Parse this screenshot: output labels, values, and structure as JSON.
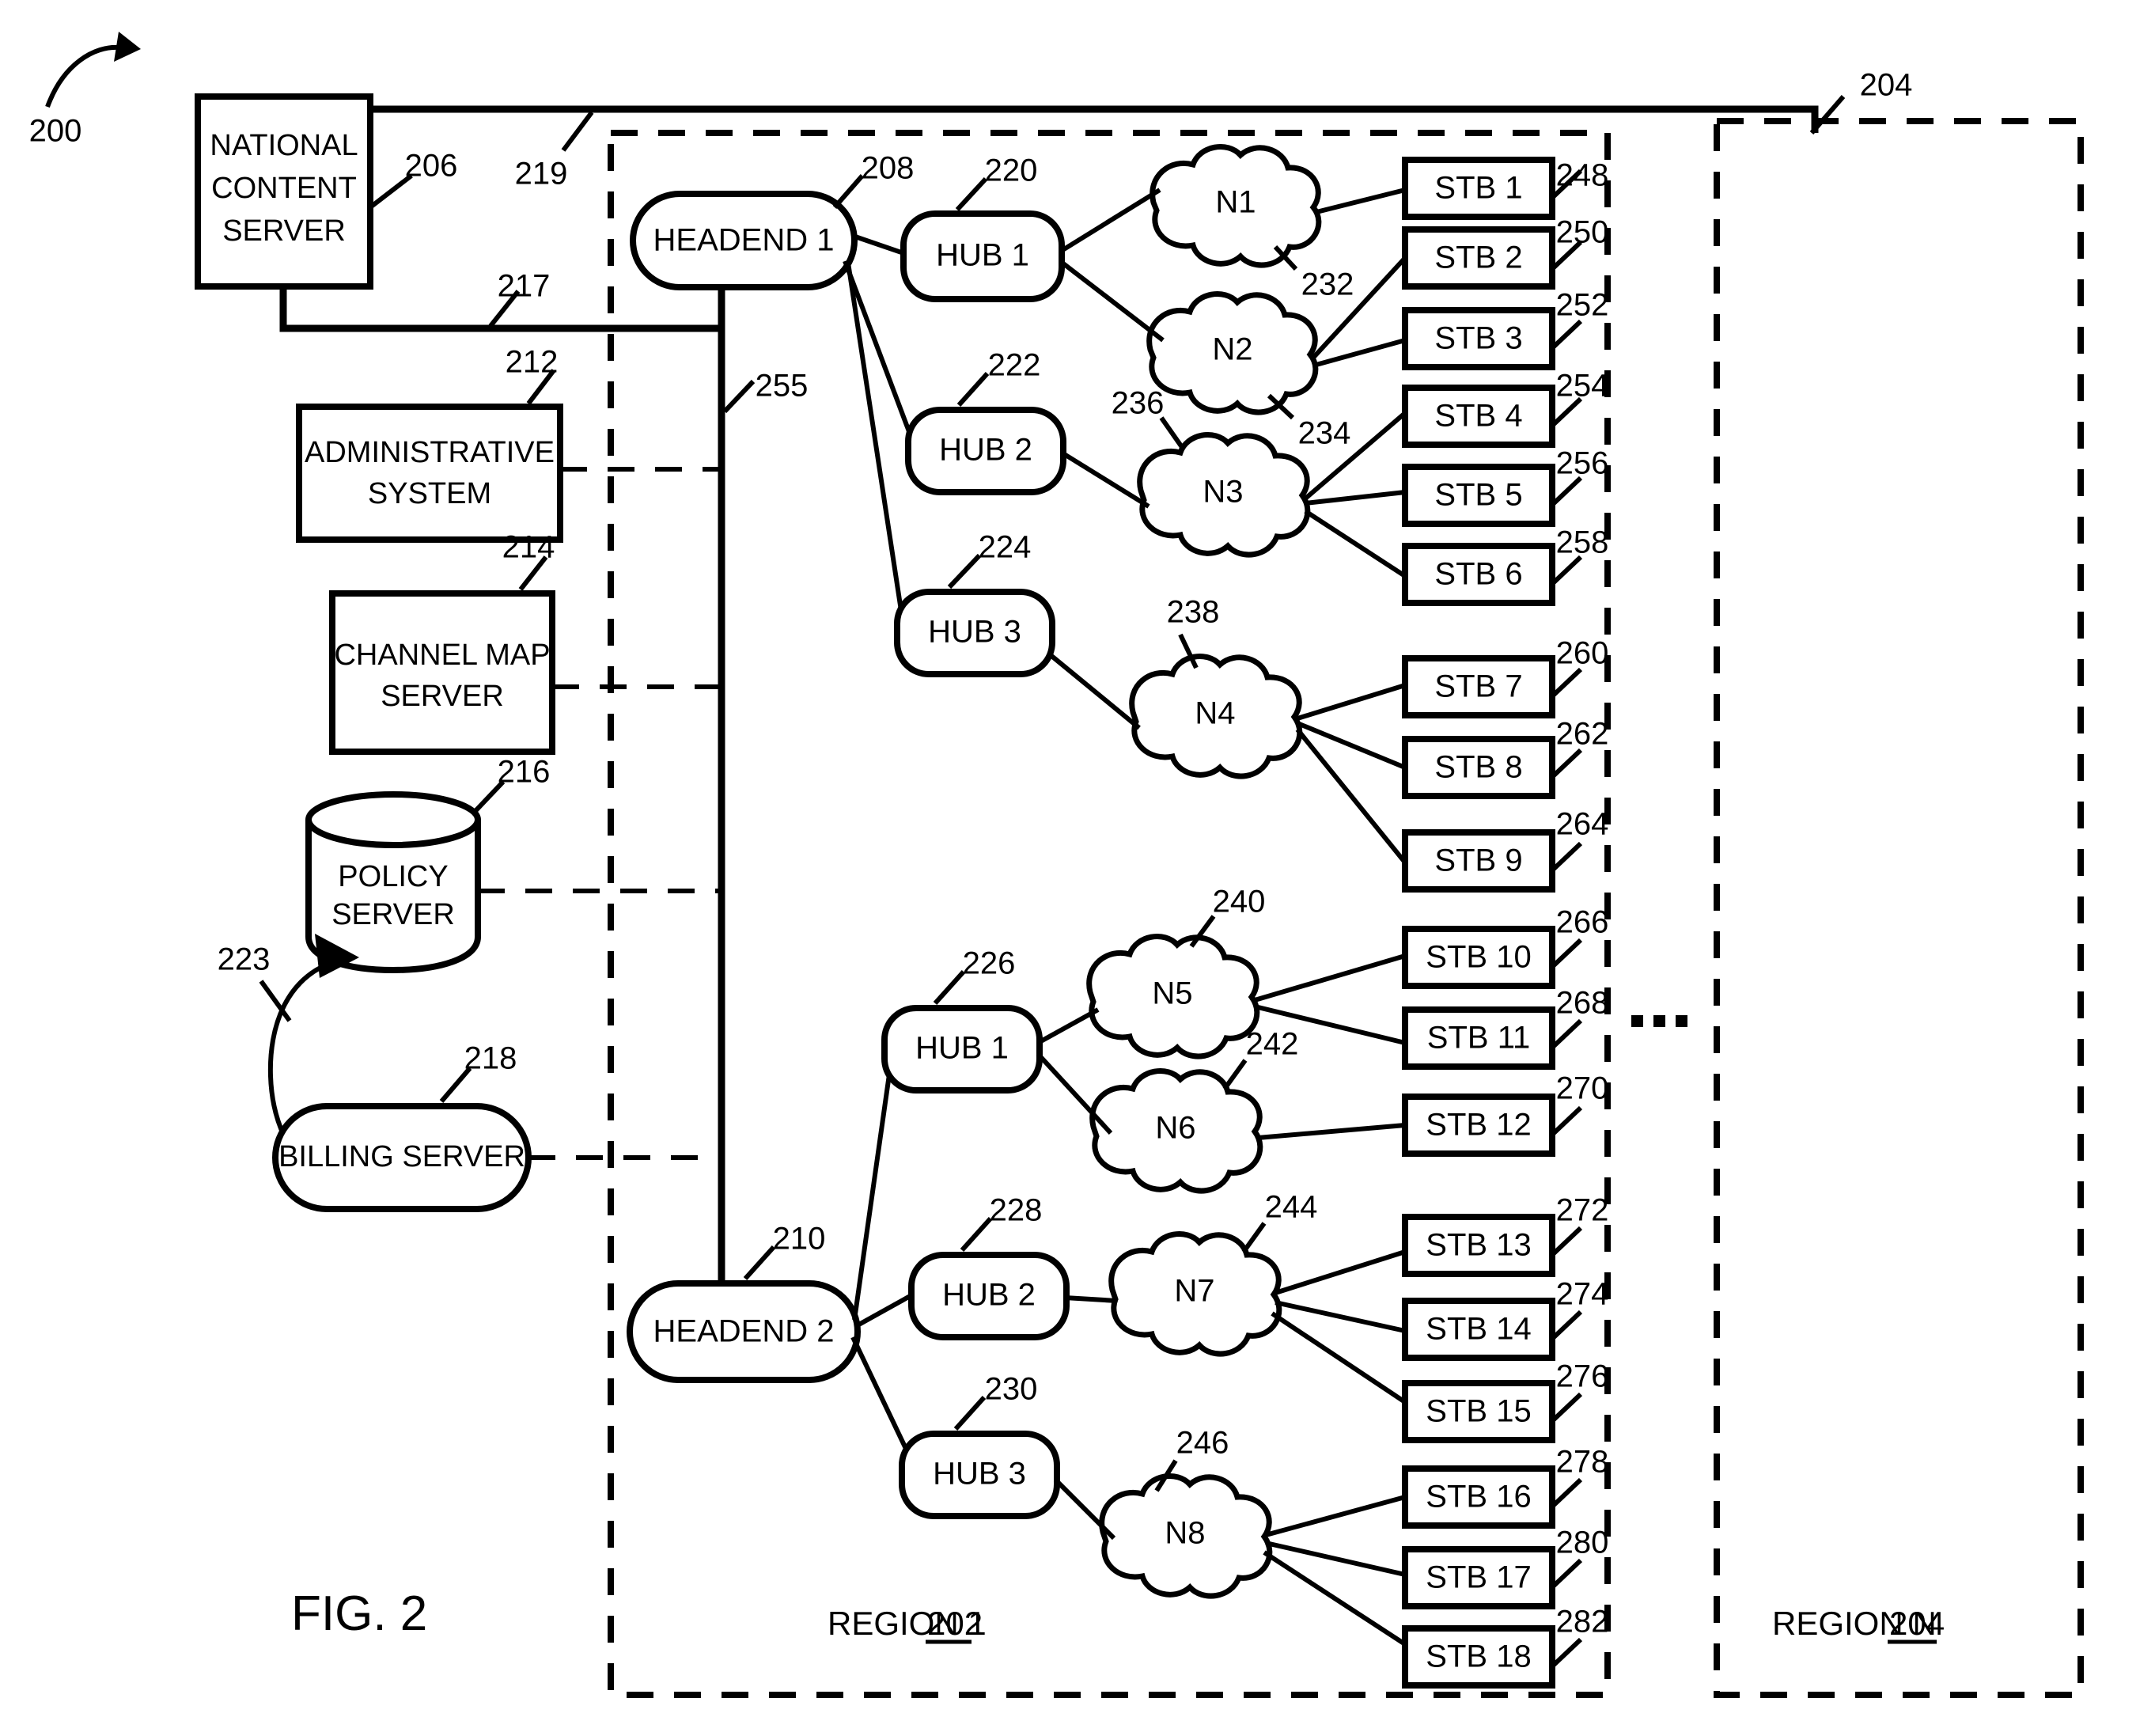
{
  "figure": {
    "label": "FIG. 2",
    "system_ref": "200"
  },
  "regions": [
    {
      "name": "REGION 1",
      "ref": "202"
    },
    {
      "name": "REGION N",
      "ref": "204"
    }
  ],
  "ellipsis": "...",
  "servers": [
    {
      "id": "national-content-server",
      "line1": "NATIONAL",
      "line2": "CONTENT",
      "line3": "SERVER",
      "ref": "206",
      "shape": "rect"
    },
    {
      "id": "administrative-system",
      "line1": "ADMINISTRATIVE",
      "line2": "SYSTEM",
      "ref": "212",
      "shape": "rect"
    },
    {
      "id": "channel-map-server",
      "line1": "CHANNEL MAP",
      "line2": "SERVER",
      "ref": "214",
      "shape": "rect"
    },
    {
      "id": "policy-server",
      "line1": "POLICY",
      "line2": "SERVER",
      "ref": "216",
      "shape": "cylinder"
    },
    {
      "id": "billing-server",
      "line1": "BILLING SERVER",
      "ref": "218",
      "shape": "stadium"
    }
  ],
  "links": [
    {
      "id": "link-219",
      "ref": "219"
    },
    {
      "id": "link-217",
      "ref": "217"
    },
    {
      "id": "link-223",
      "ref": "223"
    },
    {
      "id": "link-255",
      "ref": "255"
    }
  ],
  "headends": [
    {
      "label": "HEADEND 1",
      "ref": "208"
    },
    {
      "label": "HEADEND 2",
      "ref": "210"
    }
  ],
  "hubs": [
    {
      "label": "HUB 1",
      "ref": "220",
      "headend": "HEADEND 1"
    },
    {
      "label": "HUB 2",
      "ref": "222",
      "headend": "HEADEND 1"
    },
    {
      "label": "HUB 3",
      "ref": "224",
      "headend": "HEADEND 1"
    },
    {
      "label": "HUB 1",
      "ref": "226",
      "headend": "HEADEND 2"
    },
    {
      "label": "HUB 2",
      "ref": "228",
      "headend": "HEADEND 2"
    },
    {
      "label": "HUB 3",
      "ref": "230",
      "headend": "HEADEND 2"
    }
  ],
  "networks": [
    {
      "label": "N1",
      "ref": "232"
    },
    {
      "label": "N2",
      "ref": "234"
    },
    {
      "label": "N3",
      "ref": "236"
    },
    {
      "label": "N4",
      "ref": "238"
    },
    {
      "label": "N5",
      "ref": "240"
    },
    {
      "label": "N6",
      "ref": "242"
    },
    {
      "label": "N7",
      "ref": "244"
    },
    {
      "label": "N8",
      "ref": "246"
    }
  ],
  "set_top_boxes": [
    {
      "label": "STB 1",
      "ref": "248"
    },
    {
      "label": "STB 2",
      "ref": "250"
    },
    {
      "label": "STB 3",
      "ref": "252"
    },
    {
      "label": "STB 4",
      "ref": "254"
    },
    {
      "label": "STB 5",
      "ref": "256"
    },
    {
      "label": "STB 6",
      "ref": "258"
    },
    {
      "label": "STB 7",
      "ref": "260"
    },
    {
      "label": "STB 8",
      "ref": "262"
    },
    {
      "label": "STB 9",
      "ref": "264"
    },
    {
      "label": "STB 10",
      "ref": "266"
    },
    {
      "label": "STB 11",
      "ref": "268"
    },
    {
      "label": "STB 12",
      "ref": "270"
    },
    {
      "label": "STB 13",
      "ref": "272"
    },
    {
      "label": "STB 14",
      "ref": "274"
    },
    {
      "label": "STB 15",
      "ref": "276"
    },
    {
      "label": "STB 16",
      "ref": "278"
    },
    {
      "label": "STB 17",
      "ref": "280"
    },
    {
      "label": "STB 18",
      "ref": "282"
    }
  ],
  "colors": {
    "ink": "#000000",
    "paper": "#ffffff"
  }
}
